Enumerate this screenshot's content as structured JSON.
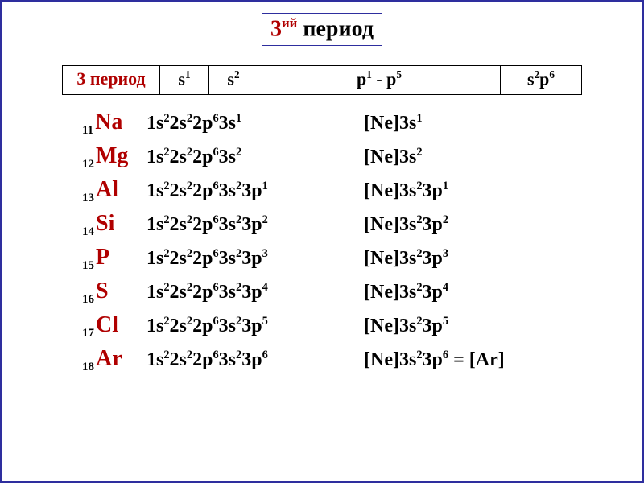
{
  "title": {
    "number": "3",
    "sup": "ий",
    "word": "период"
  },
  "header": {
    "period_label": "3 период",
    "s1_html": "s<sup>1</sup>",
    "s2_html": "s<sup>2</sup>",
    "p_html": "p<sup>1</sup> - p<sup>5</sup>",
    "sp_html": "s<sup>2</sup>p<sup>6</sup>"
  },
  "elements": [
    {
      "Z": "11",
      "symbol": "Na",
      "full_html": "1s<sup>2</sup>2s<sup>2</sup>2p<sup>6</sup>3s<sup>1</sup>",
      "short_html": "[Ne]3s<sup>1</sup>"
    },
    {
      "Z": "12",
      "symbol": "Mg",
      "full_html": "1s<sup>2</sup>2s<sup>2</sup>2p<sup>6</sup>3s<sup>2</sup>",
      "short_html": "[Ne]3s<sup>2</sup>"
    },
    {
      "Z": "13",
      "symbol": "Al",
      "full_html": "1s<sup>2</sup>2s<sup>2</sup>2p<sup>6</sup>3s<sup>2</sup>3p<sup>1</sup>",
      "short_html": "[Ne]3s<sup>2</sup>3p<sup>1</sup>"
    },
    {
      "Z": "14",
      "symbol": "Si",
      "full_html": "1s<sup>2</sup>2s<sup>2</sup>2p<sup>6</sup>3s<sup>2</sup>3p<sup>2</sup>",
      "short_html": "[Ne]3s<sup>2</sup>3p<sup>2</sup>"
    },
    {
      "Z": "15",
      "symbol": "P",
      "full_html": "1s<sup>2</sup>2s<sup>2</sup>2p<sup>6</sup>3s<sup>2</sup>3p<sup>3</sup>",
      "short_html": "[Ne]3s<sup>2</sup>3p<sup>3</sup>"
    },
    {
      "Z": "16",
      "symbol": "S",
      "full_html": "1s<sup>2</sup>2s<sup>2</sup>2p<sup>6</sup>3s<sup>2</sup>3p<sup>4</sup>",
      "short_html": "[Ne]3s<sup>2</sup>3p<sup>4</sup>"
    },
    {
      "Z": "17",
      "symbol": "Cl",
      "full_html": "1s<sup>2</sup>2s<sup>2</sup>2p<sup>6</sup>3s<sup>2</sup>3p<sup>5</sup>",
      "short_html": "[Ne]3s<sup>2</sup>3p<sup>5</sup>"
    },
    {
      "Z": "18",
      "symbol": "Ar",
      "full_html": "1s<sup>2</sup>2s<sup>2</sup>2p<sup>6</sup>3s<sup>2</sup>3p<sup>6</sup>",
      "short_html": "[Ne]3s<sup>2</sup>3p<sup>6</sup> = [Ar]"
    }
  ]
}
